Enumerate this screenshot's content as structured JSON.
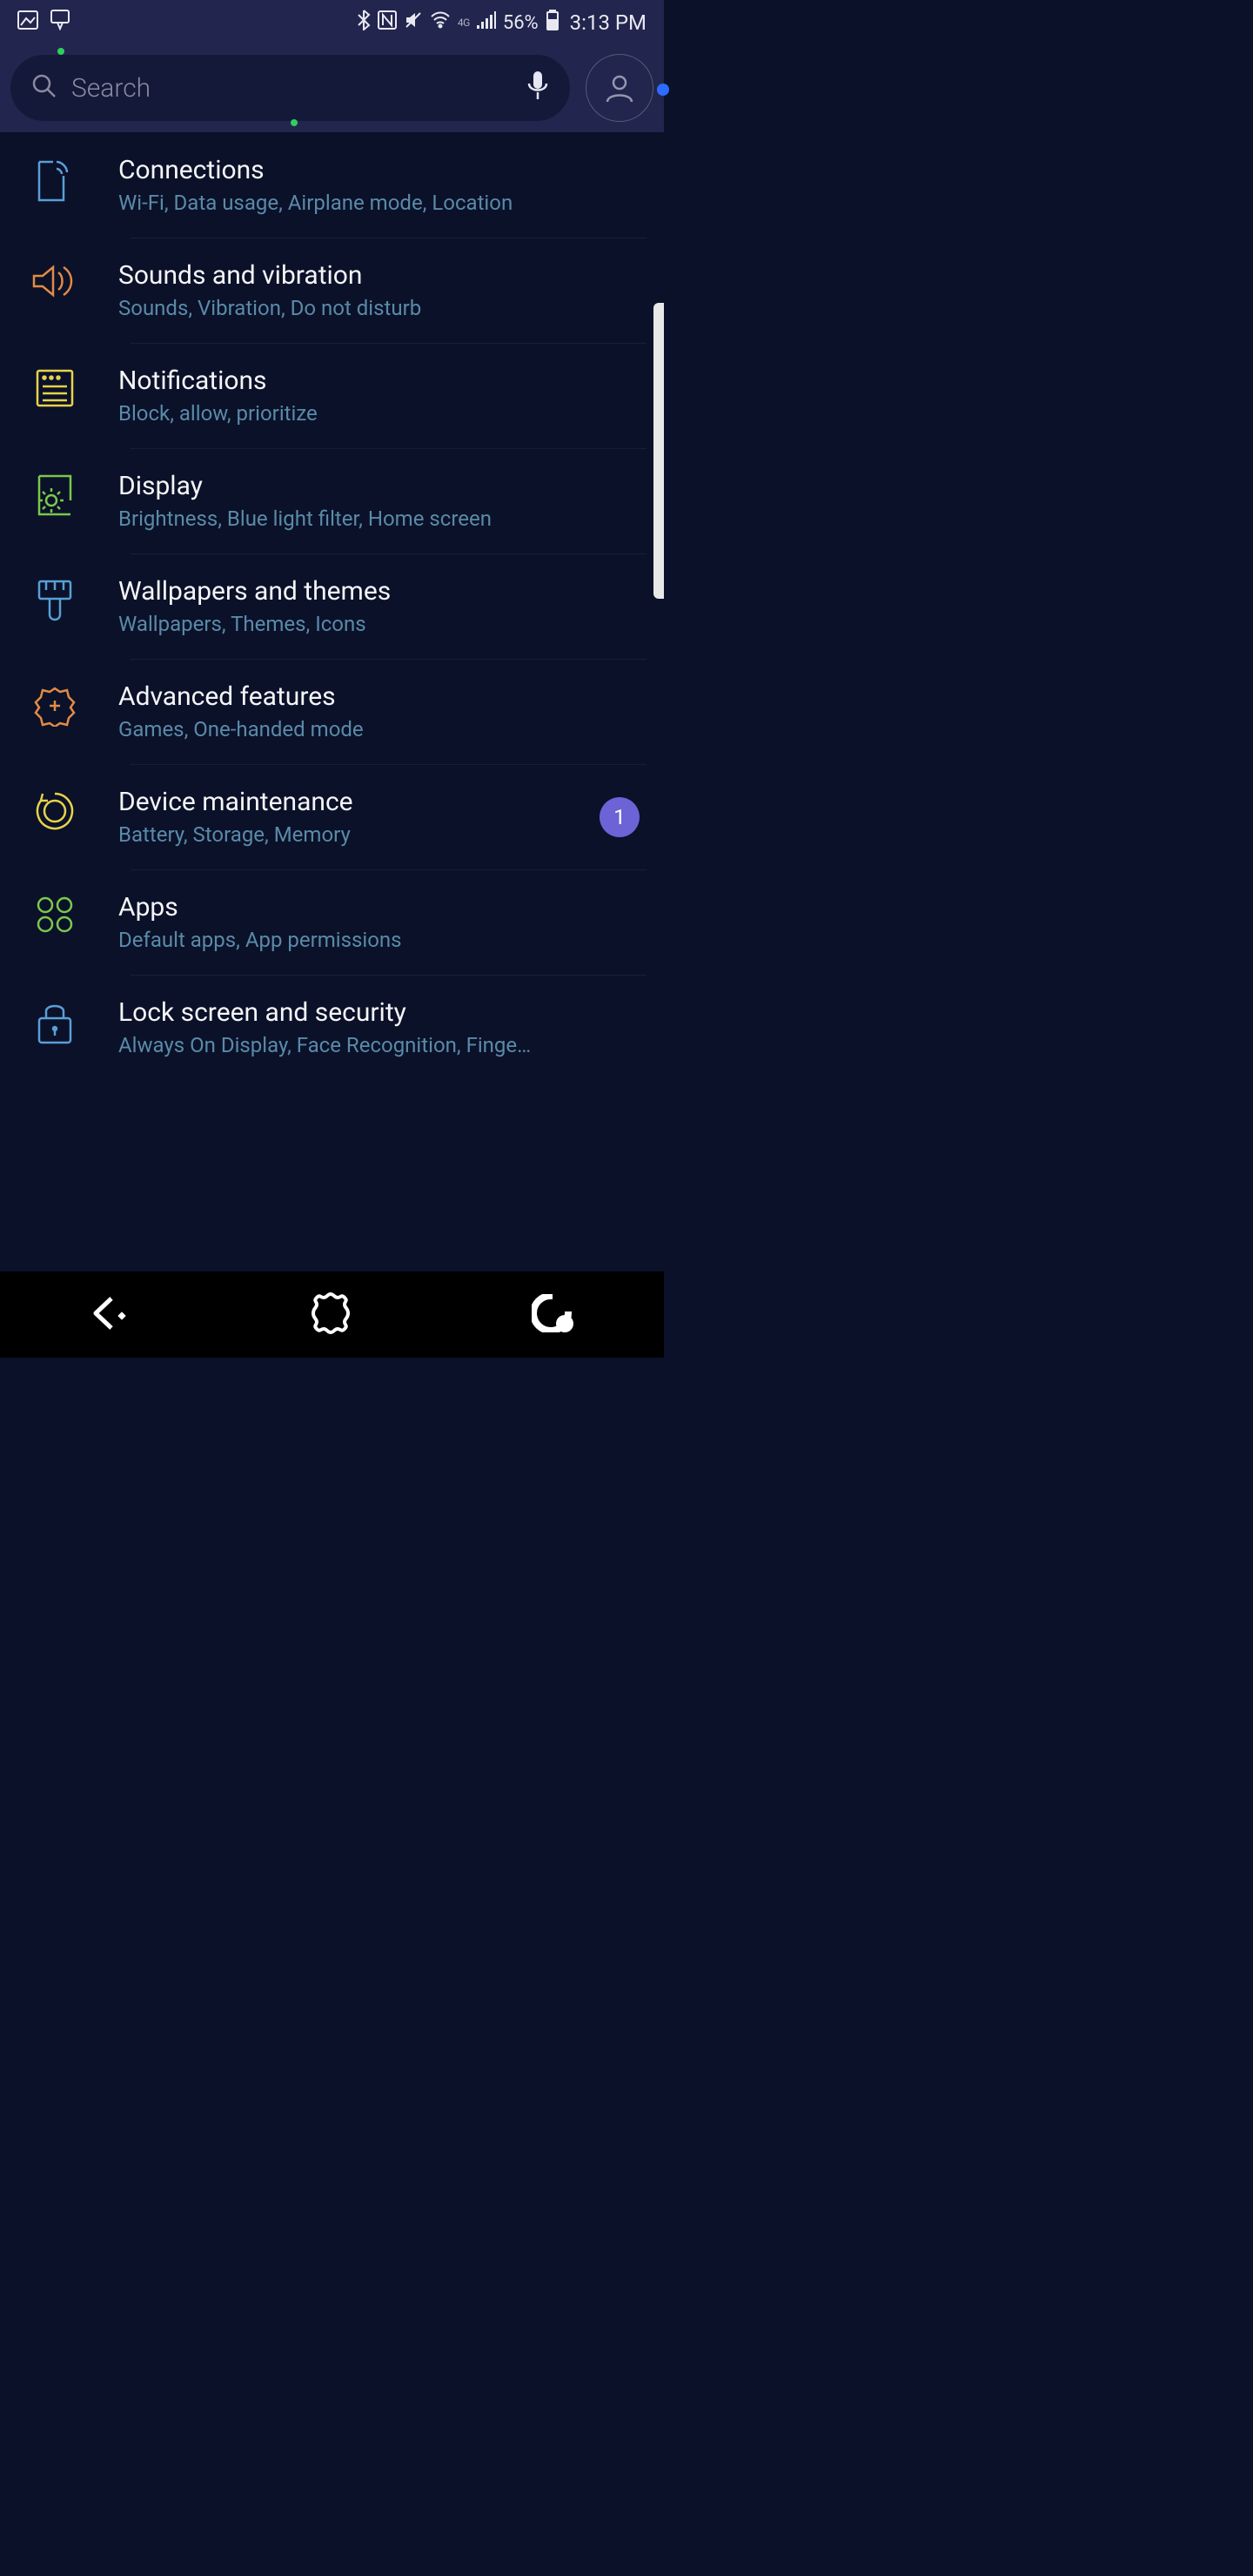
{
  "status": {
    "battery_pct": "56%",
    "time": "3:13 PM",
    "network_label": "4G"
  },
  "header": {
    "search_placeholder": "Search"
  },
  "settings": [
    {
      "id": "connections",
      "title": "Connections",
      "sub": "Wi-Fi, Data usage, Airplane mode, Location",
      "icon": "connections",
      "color": "#5a9fd6"
    },
    {
      "id": "sounds",
      "title": "Sounds and vibration",
      "sub": "Sounds, Vibration, Do not disturb",
      "icon": "volume",
      "color": "#e38b45"
    },
    {
      "id": "notifications",
      "title": "Notifications",
      "sub": "Block, allow, prioritize",
      "icon": "list",
      "color": "#e8d24b"
    },
    {
      "id": "display",
      "title": "Display",
      "sub": "Brightness, Blue light filter, Home screen",
      "icon": "display",
      "color": "#7bc84b"
    },
    {
      "id": "wallpapers",
      "title": "Wallpapers and themes",
      "sub": "Wallpapers, Themes, Icons",
      "icon": "brush",
      "color": "#5a9fd6"
    },
    {
      "id": "advanced",
      "title": "Advanced features",
      "sub": "Games, One-handed mode",
      "icon": "gear-plus",
      "color": "#e38b45"
    },
    {
      "id": "maintenance",
      "title": "Device maintenance",
      "sub": "Battery, Storage, Memory",
      "icon": "reload",
      "color": "#e8d24b",
      "badge": "1"
    },
    {
      "id": "apps",
      "title": "Apps",
      "sub": "Default apps, App permissions",
      "icon": "grid4",
      "color": "#7bc84b"
    },
    {
      "id": "lock",
      "title": "Lock screen and security",
      "sub": "Always On Display, Face Recognition, Finge…",
      "icon": "lock",
      "color": "#5a9fd6"
    }
  ]
}
